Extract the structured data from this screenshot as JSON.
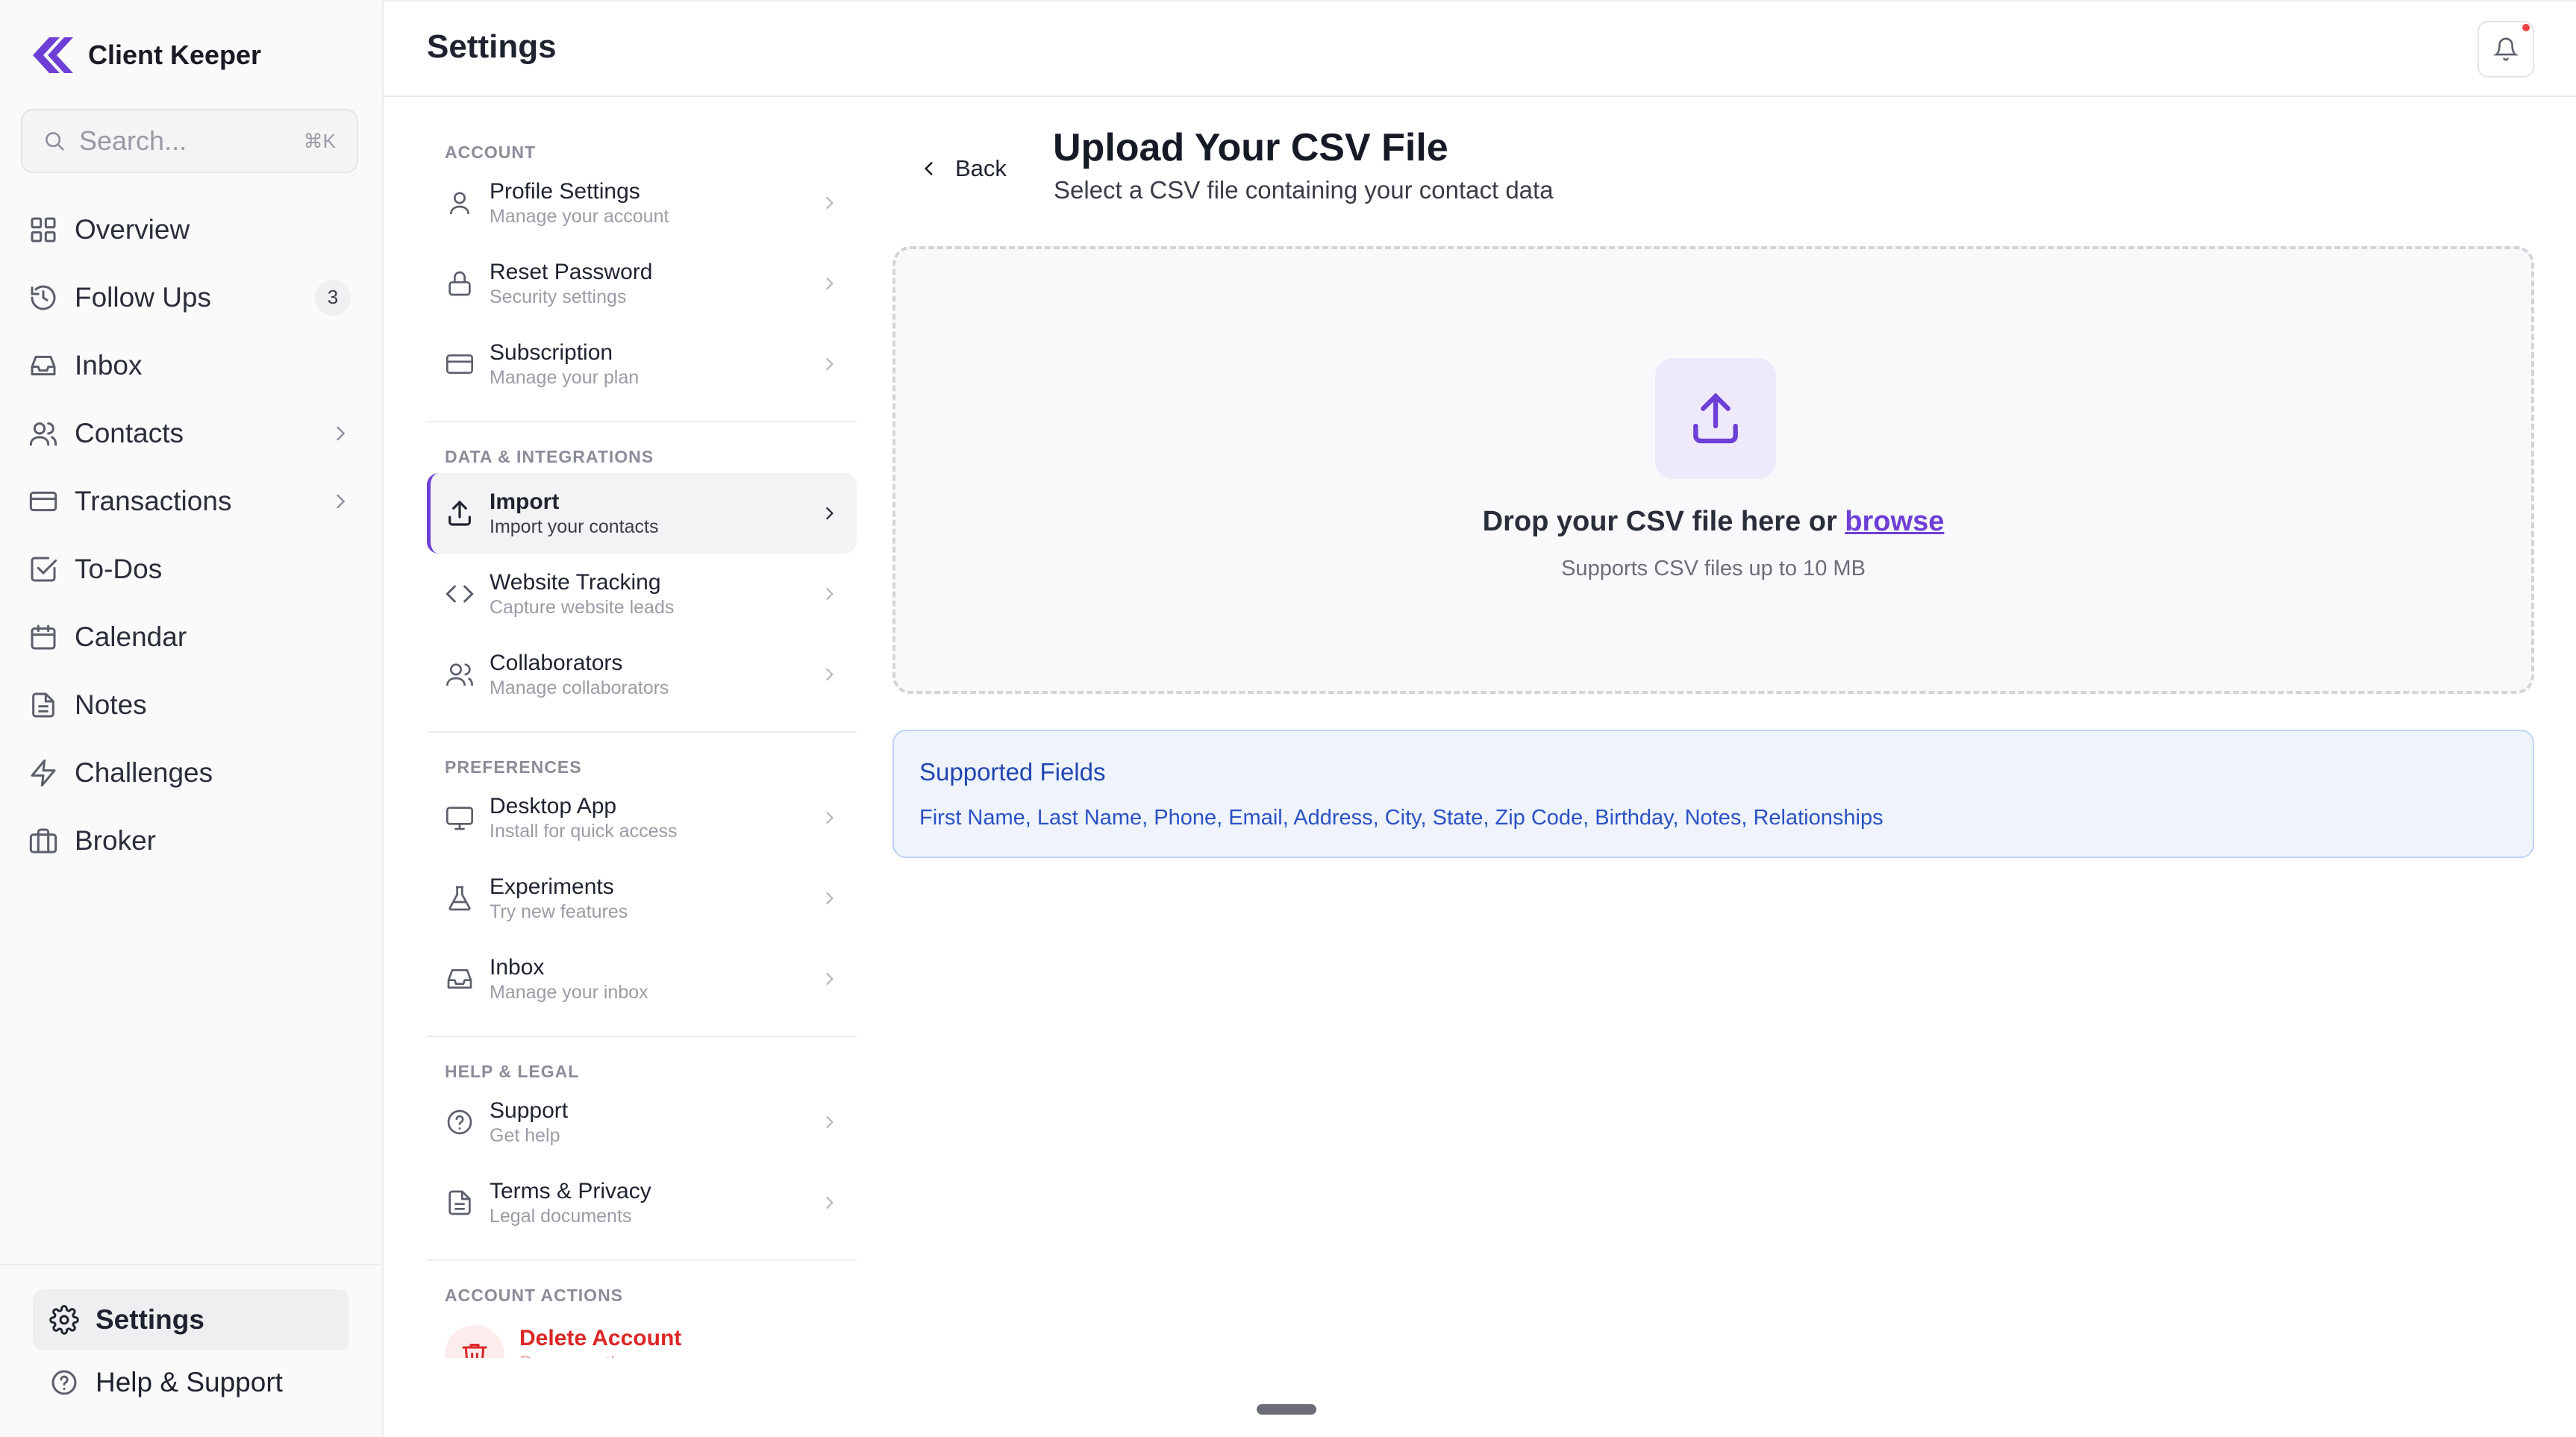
{
  "app": {
    "name": "Client Keeper",
    "accent": "#6d3fd6"
  },
  "search": {
    "placeholder": "Search...",
    "shortcut": "⌘K"
  },
  "nav": {
    "items": [
      {
        "label": "Overview",
        "icon": "grid-icon"
      },
      {
        "label": "Follow Ups",
        "icon": "history-icon",
        "badge": "3"
      },
      {
        "label": "Inbox",
        "icon": "inbox-icon"
      },
      {
        "label": "Contacts",
        "icon": "users-icon",
        "chevron": true
      },
      {
        "label": "Transactions",
        "icon": "credit-card-icon",
        "chevron": true
      },
      {
        "label": "To-Dos",
        "icon": "check-square-icon"
      },
      {
        "label": "Calendar",
        "icon": "calendar-icon"
      },
      {
        "label": "Notes",
        "icon": "file-text-icon"
      },
      {
        "label": "Challenges",
        "icon": "zap-icon"
      },
      {
        "label": "Broker",
        "icon": "briefcase-icon"
      }
    ],
    "bottom": [
      {
        "label": "Settings",
        "icon": "gear-icon",
        "active": true
      },
      {
        "label": "Help & Support",
        "icon": "help-circle-icon"
      }
    ]
  },
  "header": {
    "title": "Settings"
  },
  "menu": {
    "sections": {
      "account": "ACCOUNT",
      "data": "DATA & INTEGRATIONS",
      "preferences": "PREFERENCES",
      "help": "HELP & LEGAL",
      "actions": "ACCOUNT ACTIONS"
    },
    "items": {
      "profile": {
        "title": "Profile Settings",
        "sub": "Manage your account"
      },
      "reset": {
        "title": "Reset Password",
        "sub": "Security settings"
      },
      "subscription": {
        "title": "Subscription",
        "sub": "Manage your plan"
      },
      "import": {
        "title": "Import",
        "sub": "Import your contacts"
      },
      "tracking": {
        "title": "Website Tracking",
        "sub": "Capture website leads"
      },
      "collaborators": {
        "title": "Collaborators",
        "sub": "Manage collaborators"
      },
      "desktop": {
        "title": "Desktop App",
        "sub": "Install for quick access"
      },
      "experiments": {
        "title": "Experiments",
        "sub": "Try new features"
      },
      "inbox": {
        "title": "Inbox",
        "sub": "Manage your inbox"
      },
      "support": {
        "title": "Support",
        "sub": "Get help"
      },
      "terms": {
        "title": "Terms & Privacy",
        "sub": "Legal documents"
      },
      "delete": {
        "title": "Delete Account",
        "sub": "Permanently remove"
      }
    }
  },
  "content": {
    "back_label": "Back",
    "title": "Upload Your CSV File",
    "subtitle": "Select a CSV file containing your contact data",
    "drop_text": "Drop your CSV file here or",
    "browse_link": "browse",
    "drop_hint": "Supports CSV files up to 10 MB",
    "fields_title": "Supported Fields",
    "fields_list": "First Name, Last Name, Phone, Email, Address, City, State, Zip Code, Birthday, Notes, Relationships"
  }
}
